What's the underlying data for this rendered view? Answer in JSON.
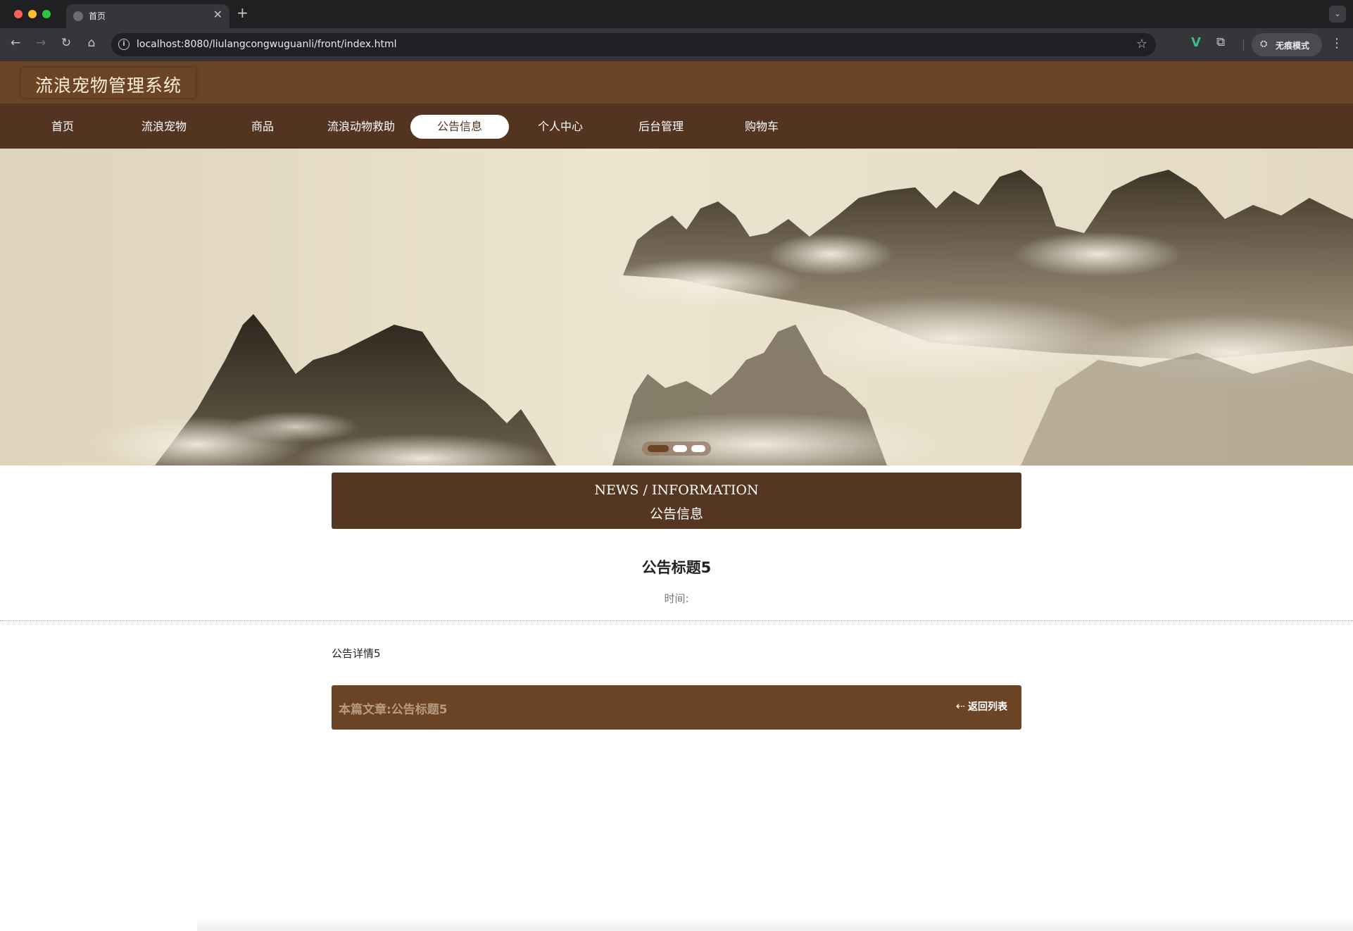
{
  "browser": {
    "tab_title": "首页",
    "tab_close": "✕",
    "new_tab": "+",
    "tab_menu": "⌄",
    "url": "localhost:8080/liulangcongwuguanli/front/index.html",
    "incognito_label": "无痕模式",
    "icons": {
      "back": "←",
      "forward": "→",
      "reload": "↻",
      "home": "⌂",
      "info": "i",
      "star": "☆",
      "extension_v": "V",
      "extensions": "⧉",
      "incognito": "⛭",
      "menu": "⋮"
    }
  },
  "site": {
    "title": "流浪宠物管理系统",
    "nav": [
      {
        "label": "首页",
        "active": false
      },
      {
        "label": "流浪宠物",
        "active": false
      },
      {
        "label": "商品",
        "active": false
      },
      {
        "label": "流浪动物救助",
        "active": false
      },
      {
        "label": "公告信息",
        "active": true
      },
      {
        "label": "个人中心",
        "active": false
      },
      {
        "label": "后台管理",
        "active": false
      },
      {
        "label": "购物车",
        "active": false
      }
    ]
  },
  "banner": {
    "slide_count": 3,
    "active_slide": 1
  },
  "section": {
    "title_en": "NEWS / INFORMATION",
    "title_zh": "公告信息"
  },
  "article": {
    "title": "公告标题5",
    "time_label": "时间:",
    "body": "公告详情5"
  },
  "footer": {
    "current_label": "本篇文章:公告标题5",
    "back_icon": "⇠",
    "back_label": "返回列表"
  },
  "colors": {
    "header_brown": "#6b4426",
    "nav_brown": "#523421",
    "section_brown": "#553620",
    "logo_text": "#fcefd9",
    "footer_label": "#b69a82"
  }
}
